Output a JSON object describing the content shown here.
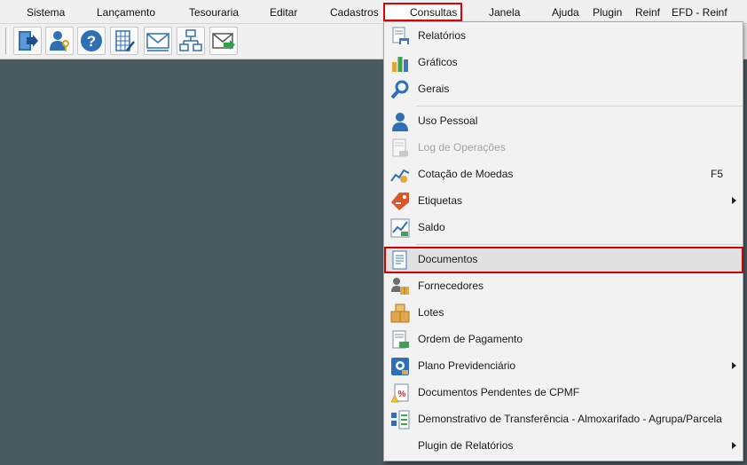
{
  "menubar": {
    "items": [
      "Sistema",
      "Lançamento",
      "Tesouraria",
      "Editar",
      "Cadastros",
      "Consultas",
      "Janela",
      "Ajuda",
      "Plugin",
      "Reinf",
      "EFD - Reinf"
    ],
    "active": "Consultas"
  },
  "toolbar": {
    "buttons": [
      "exit-door-icon",
      "user-key-icon",
      "help-icon",
      "calculator-grid-icon",
      "mail-icon",
      "network-icon",
      "mail-send-icon"
    ]
  },
  "dropdown": {
    "items": [
      {
        "label": "Relatórios",
        "icon": "report-printer-icon",
        "enabled": true
      },
      {
        "label": "Gráficos",
        "icon": "bar-chart-icon",
        "enabled": true
      },
      {
        "label": "Gerais",
        "icon": "magnifier-icon",
        "enabled": true
      },
      {
        "label": "Uso Pessoal",
        "icon": "person-icon",
        "enabled": true
      },
      {
        "label": "Log de Operações",
        "icon": "log-document-icon",
        "enabled": false
      },
      {
        "label": "Cotação de Moedas",
        "icon": "currency-chart-icon",
        "enabled": true,
        "shortcut": "F5"
      },
      {
        "label": "Etiquetas",
        "icon": "price-tag-icon",
        "enabled": true,
        "submenu": true
      },
      {
        "label": "Saldo",
        "icon": "balance-chart-icon",
        "enabled": true
      },
      {
        "label": "Documentos",
        "icon": "document-icon",
        "enabled": true,
        "selected": true
      },
      {
        "label": "Fornecedores",
        "icon": "suppliers-icon",
        "enabled": true
      },
      {
        "label": "Lotes",
        "icon": "boxes-icon",
        "enabled": true
      },
      {
        "label": "Ordem de Pagamento",
        "icon": "payment-order-icon",
        "enabled": true
      },
      {
        "label": "Plano Previdenciário",
        "icon": "pension-plan-icon",
        "enabled": true,
        "submenu": true
      },
      {
        "label": "Documentos Pendentes de CPMF",
        "icon": "pending-document-icon",
        "enabled": true
      },
      {
        "label": "Demonstrativo de Transferência - Almoxarifado - Agrupa/Parcela",
        "icon": "transfer-report-icon",
        "enabled": true
      },
      {
        "label": "Plugin de Relatórios",
        "icon": "blank",
        "enabled": true,
        "submenu": true
      }
    ]
  },
  "colors": {
    "desktop": "#4a5a61",
    "highlight": "#d40000",
    "menu_bg": "#f2f2f2"
  }
}
